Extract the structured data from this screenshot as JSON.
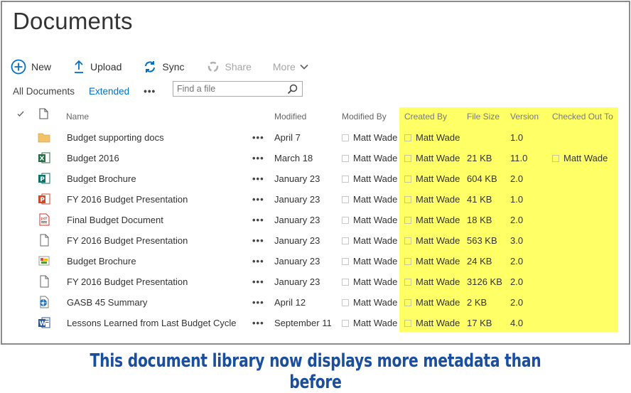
{
  "page": {
    "title": "Documents",
    "caption": "This document library now displays more metadata than before"
  },
  "commands": {
    "new": "New",
    "upload": "Upload",
    "sync": "Sync",
    "share": "Share",
    "more": "More"
  },
  "views": {
    "all": "All Documents",
    "extended": "Extended"
  },
  "search": {
    "placeholder": "Find a file"
  },
  "columns": {
    "name": "Name",
    "modified": "Modified",
    "modified_by": "Modified By",
    "created_by": "Created By",
    "file_size": "File Size",
    "version": "Version",
    "checked_out_to": "Checked Out To"
  },
  "colors": {
    "highlight": "#ffff66",
    "accent": "#0072c6",
    "caption": "#1a4fa0"
  },
  "rows": [
    {
      "icon": "folder-icon",
      "name": "Budget supporting docs",
      "modified": "April 7",
      "modified_by": "Matt Wade",
      "created_by": "Matt Wade",
      "file_size": "",
      "version": "1.0",
      "checked_out_to": ""
    },
    {
      "icon": "excel-icon",
      "name": "Budget 2016",
      "modified": "March 18",
      "modified_by": "Matt Wade",
      "created_by": "Matt Wade",
      "file_size": "21 KB",
      "version": "11.0",
      "checked_out_to": "Matt Wade"
    },
    {
      "icon": "publisher-icon",
      "name": "Budget Brochure",
      "modified": "January 23",
      "modified_by": "Matt Wade",
      "created_by": "Matt Wade",
      "file_size": "604 KB",
      "version": "2.0",
      "checked_out_to": ""
    },
    {
      "icon": "powerpoint-icon",
      "name": "FY 2016 Budget Presentation",
      "modified": "January 23",
      "modified_by": "Matt Wade",
      "created_by": "Matt Wade",
      "file_size": "41 KB",
      "version": "1.0",
      "checked_out_to": ""
    },
    {
      "icon": "pdf-icon",
      "name": "Final Budget Document",
      "modified": "January 23",
      "modified_by": "Matt Wade",
      "created_by": "Matt Wade",
      "file_size": "18 KB",
      "version": "2.0",
      "checked_out_to": ""
    },
    {
      "icon": "generic-file-icon",
      "name": "FY 2016 Budget Presentation",
      "modified": "January 23",
      "modified_by": "Matt Wade",
      "created_by": "Matt Wade",
      "file_size": "563 KB",
      "version": "3.0",
      "checked_out_to": ""
    },
    {
      "icon": "image-file-icon",
      "name": "Budget Brochure",
      "modified": "January 23",
      "modified_by": "Matt Wade",
      "created_by": "Matt Wade",
      "file_size": "24 KB",
      "version": "2.0",
      "checked_out_to": ""
    },
    {
      "icon": "generic-file-icon",
      "name": "FY 2016 Budget Presentation",
      "modified": "January 23",
      "modified_by": "Matt Wade",
      "created_by": "Matt Wade",
      "file_size": "3126 KB",
      "version": "2.0",
      "checked_out_to": ""
    },
    {
      "icon": "web-file-icon",
      "name": "GASB 45 Summary",
      "modified": "April 12",
      "modified_by": "Matt Wade",
      "created_by": "Matt Wade",
      "file_size": "2 KB",
      "version": "2.0",
      "checked_out_to": ""
    },
    {
      "icon": "word-icon",
      "name": "Lessons Learned from Last Budget Cycle",
      "modified": "September 11",
      "modified_by": "Matt Wade",
      "created_by": "Matt Wade",
      "file_size": "17 KB",
      "version": "4.0",
      "checked_out_to": ""
    }
  ]
}
